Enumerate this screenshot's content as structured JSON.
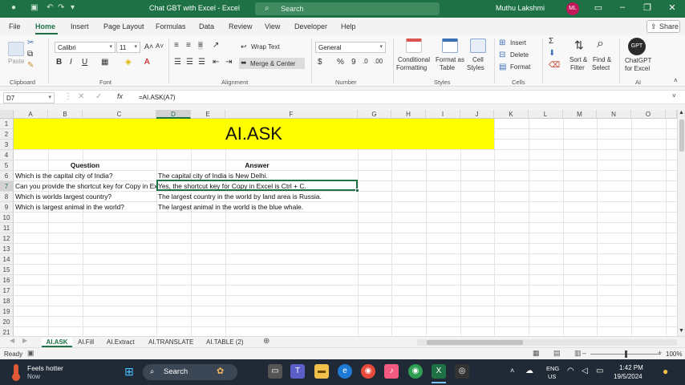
{
  "window": {
    "title": "Chat GBT with Excel  -  Excel",
    "search_placeholder": "Search",
    "user_name": "Muthu Lakshmi",
    "user_initials": "ML"
  },
  "menu": {
    "tabs": [
      "File",
      "Home",
      "Insert",
      "Page Layout",
      "Formulas",
      "Data",
      "Review",
      "View",
      "Developer",
      "Help"
    ],
    "active_tab": "Home",
    "share_label": "Share"
  },
  "ribbon": {
    "clipboard": {
      "paste_label": "Paste",
      "group_label": "Clipboard"
    },
    "font": {
      "font_name": "Calibri",
      "font_size": "11",
      "group_label": "Font",
      "bold": "B",
      "italic": "I",
      "underline": "U"
    },
    "alignment": {
      "wrap_text": "Wrap Text",
      "merge_center": "Merge & Center",
      "group_label": "Alignment"
    },
    "number": {
      "format": "General",
      "group_label": "Number",
      "currency": "$",
      "percent": "%",
      "comma": "9"
    },
    "styles": {
      "conditional_formatting_1": "Conditional",
      "conditional_formatting_2": "Formatting",
      "format_as_table_1": "Format as",
      "format_as_table_2": "Table",
      "cell_styles_1": "Cell",
      "cell_styles_2": "Styles",
      "group_label": "Styles"
    },
    "cells": {
      "insert": "Insert",
      "delete": "Delete",
      "format": "Format",
      "group_label": "Cells"
    },
    "editing": {
      "sort_filter_1": "Sort &",
      "sort_filter_2": "Filter",
      "find_select_1": "Find &",
      "find_select_2": "Select"
    },
    "ai": {
      "chatgpt_1": "ChatGPT",
      "chatgpt_2": "for Excel",
      "group_label": "AI",
      "gpt_badge": "GPT"
    }
  },
  "formula_bar": {
    "name_box": "D7",
    "fx": "fx",
    "formula": "=AI.ASK(A7)"
  },
  "grid": {
    "columns": [
      "A",
      "B",
      "C",
      "D",
      "E",
      "F",
      "G",
      "H",
      "I",
      "J",
      "K",
      "L",
      "M",
      "N",
      "O"
    ],
    "rows": [
      "1",
      "2",
      "3",
      "4",
      "5",
      "6",
      "7",
      "8",
      "9",
      "10",
      "11",
      "12",
      "13",
      "14",
      "15",
      "16",
      "17",
      "18",
      "19",
      "20",
      "21"
    ],
    "selected_column": "D",
    "selected_row": "7",
    "banner": "AI.ASK",
    "question_header": "Question",
    "answer_header": "Answer",
    "questions": [
      "Which is the capital city of India?",
      "Can you provide the shortcut key for Copy in Excel?",
      "Which is worlds largest country?",
      "Which is largest animal in the world?"
    ],
    "answers": [
      "The capital city of India is New Delhi.",
      "Yes, the shortcut key for Copy in Excel is Ctrl + C.",
      "The largest country in the world by land area is Russia.",
      "The largest animal in the world is the blue whale."
    ]
  },
  "sheet_tabs": {
    "tabs": [
      "AI.ASK",
      "AI.Fill",
      "AI.Extract",
      "AI.TRANSLATE",
      "AI.TABLE (2)"
    ],
    "active": "AI.ASK"
  },
  "status": {
    "ready": "Ready",
    "zoom": "100%"
  },
  "taskbar": {
    "weather_title": "Feels hotter",
    "weather_sub": "Now",
    "search_label": "Search",
    "lang_1": "ENG",
    "lang_2": "US",
    "time": "1:42 PM",
    "date": "19/5/2024"
  }
}
